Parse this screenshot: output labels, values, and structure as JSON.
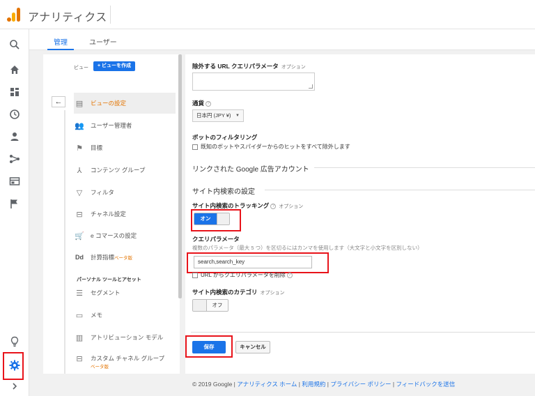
{
  "app": {
    "title": "アナリティクス"
  },
  "tabs": [
    {
      "label": "管理",
      "active": true
    },
    {
      "label": "ユーザー",
      "active": false
    }
  ],
  "leftnav": {
    "icons": [
      "search-icon",
      "home-icon",
      "dashboard-icon",
      "clock-icon",
      "person-icon",
      "acquisition-icon",
      "behavior-icon",
      "flag-icon",
      "lightbulb-icon",
      "gear-icon",
      "chevron-right-icon"
    ]
  },
  "view_panel": {
    "view_label": "ビュー",
    "create_button": "+ ビューを作成",
    "back_icon": "←",
    "items": [
      {
        "label": "ビューの設定",
        "icon": "document-icon",
        "active": true
      },
      {
        "label": "ユーザー管理者",
        "icon": "users-icon",
        "active": false
      },
      {
        "label": "目標",
        "icon": "flag-icon",
        "active": false
      },
      {
        "label": "コンテンツ グループ",
        "icon": "content-group-icon",
        "active": false
      },
      {
        "label": "フィルタ",
        "icon": "filter-icon",
        "active": false
      },
      {
        "label": "チャネル設定",
        "icon": "channel-icon",
        "active": false
      },
      {
        "label": "e コマースの設定",
        "icon": "cart-icon",
        "active": false
      },
      {
        "label": "計算指標",
        "badge": "ベータ版",
        "icon": "dd-icon",
        "active": false
      }
    ],
    "personal_section": "パーソナル ツールとアセット",
    "personal_items": [
      {
        "label": "セグメント",
        "icon": "segment-icon"
      },
      {
        "label": "メモ",
        "icon": "note-icon"
      },
      {
        "label": "アトリビューション モデル",
        "icon": "bar-chart-icon"
      },
      {
        "label": "カスタム チャネル グループ",
        "badge": "ベータ版",
        "icon": "custom-channel-icon"
      }
    ]
  },
  "settings": {
    "exclude_params": {
      "label": "除外する URL クエリパラメータ",
      "optional": "オプション",
      "value": ""
    },
    "currency": {
      "label": "通貨",
      "help": "?",
      "value": "日本円 (JPY ¥)"
    },
    "bot_filtering": {
      "label": "ボットのフィルタリング",
      "checkbox_label": "既知のボットやスパイダーからのヒットをすべて除外します",
      "checked": false
    },
    "linked_ads": {
      "title": "リンクされた Google 広告アカウント"
    },
    "site_search": {
      "title": "サイト内検索の設定",
      "tracking_label": "サイト内検索のトラッキング",
      "tracking_optional": "オプション",
      "tracking_state": "オン",
      "query_label": "クエリパラメータ",
      "query_hint": "複数のパラメータ（最大 5 つ）を区切るにはカンマを使用します（大文字と小文字を区別しない）",
      "query_value": "search,search_key",
      "strip_label": "URL からクエリパラメータを削除",
      "strip_checked": false,
      "category_label": "サイト内検索のカテゴリ",
      "category_optional": "オプション",
      "category_state": "オフ"
    },
    "buttons": {
      "save": "保存",
      "cancel": "キャンセル"
    }
  },
  "footer": {
    "copyright": "© 2019 Google",
    "links": [
      "アナリティクス ホーム",
      "利用規約",
      "プライバシー ポリシー",
      "フィードバックを送信"
    ]
  },
  "colors": {
    "accent": "#1a73e8",
    "highlight": "#e37400",
    "annotation": "#e8131a"
  }
}
